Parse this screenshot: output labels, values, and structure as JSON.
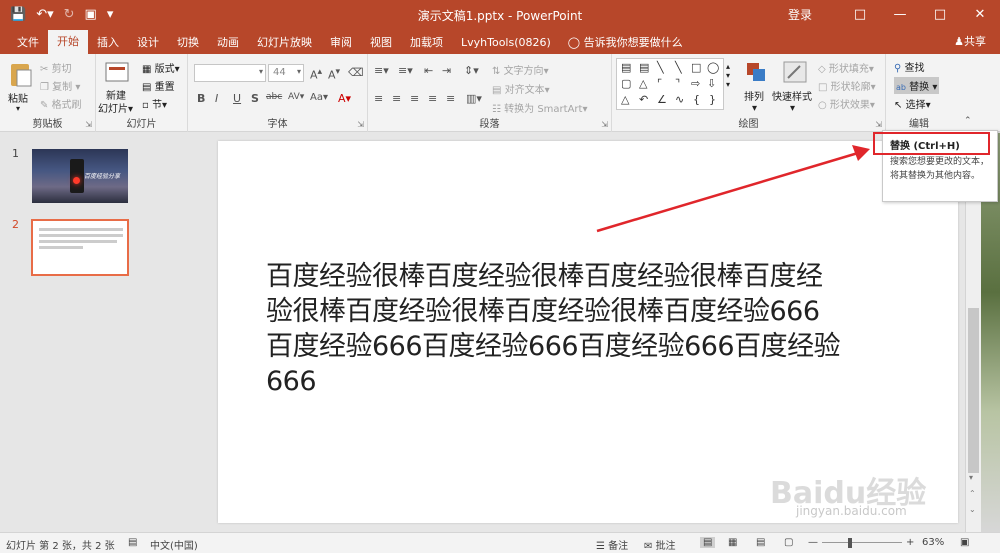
{
  "window": {
    "title": "演示文稿1.pptx - PowerPoint",
    "login": "登录"
  },
  "tabs": [
    "文件",
    "开始",
    "插入",
    "设计",
    "切换",
    "动画",
    "幻灯片放映",
    "审阅",
    "视图",
    "加载项",
    "LvyhTools(0826)"
  ],
  "active_tab_index": 1,
  "tell_me": "告诉我你想要做什么",
  "share": "共享",
  "ribbon": {
    "clipboard": {
      "label": "剪贴板",
      "paste": "粘贴",
      "cut": "剪切",
      "copy": "复制",
      "format_painter": "格式刷"
    },
    "slides": {
      "label": "幻灯片",
      "new_slide_1": "新建",
      "new_slide_2": "幻灯片",
      "layout": "版式",
      "reset": "重置",
      "section": "节"
    },
    "font": {
      "label": "字体",
      "size": "44",
      "bold": "B",
      "italic": "I",
      "underline": "U",
      "shadow": "S",
      "strike": "abc"
    },
    "paragraph": {
      "label": "段落",
      "text_direction": "文字方向",
      "align_text": "对齐文本",
      "smartart": "转换为 SmartArt"
    },
    "drawing": {
      "label": "绘图",
      "arrange": "排列",
      "quick_styles": "快速样式",
      "shape_fill": "形状填充",
      "shape_outline": "形状轮廓",
      "shape_effects": "形状效果"
    },
    "editing": {
      "label": "编辑",
      "find": "查找",
      "replace": "替换",
      "select": "选择"
    }
  },
  "thumbnails": [
    {
      "number": "1",
      "title": "百度经验分享"
    },
    {
      "number": "2"
    }
  ],
  "slide": {
    "text": "百度经验很棒百度经验很棒百度经验很棒百度经验很棒百度经验很棒百度经验很棒百度经验666百度经验666百度经验666百度经验666百度经验666"
  },
  "tooltip": {
    "title": "替换 (Ctrl+H)",
    "body": "搜索您想要更改的文本，将其替换为其他内容。"
  },
  "status": {
    "slide_info": "幻灯片 第 2 张，共 2 张",
    "language": "中文(中国)",
    "notes": "备注",
    "comments": "批注",
    "zoom": "63%"
  },
  "watermark": {
    "logo": "Baidu经验",
    "url": "jingyan.baidu.com"
  },
  "colors": {
    "accent": "#b7472a",
    "highlight": "#e0262b"
  }
}
